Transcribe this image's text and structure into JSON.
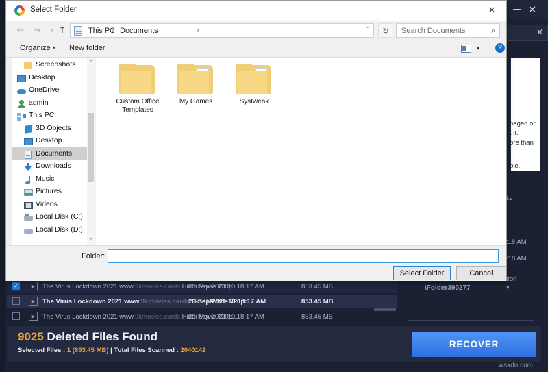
{
  "app": {
    "titlebar": {
      "minimize": "—",
      "close": "✕",
      "sub_close": "✕"
    },
    "tip_lines": [
      "naged or",
      "t it.",
      "ore than",
      ".",
      "ble."
    ],
    "right_fragments": [
      "kv",
      ":18 AM",
      ":18 AM",
      "tion",
      "y"
    ],
    "list": {
      "location_header": "tion",
      "location_value": "\\Folder390277",
      "rows": [
        {
          "checked": true,
          "name_prefix": "The Virus Lockdown 2021 www.",
          "name_dim": "9kmovies.cards",
          "name_suffix": " Hindi Movie 720p...",
          "date": "20-Sep-2021 10:18:17 AM",
          "size": "853.45 MB"
        },
        {
          "checked": false,
          "name_prefix": "The Virus Lockdown 2021 www.",
          "name_dim": "9kmovies.cards",
          "name_suffix": " Hindi Movie 720p...",
          "date": "20-Sep-2021 10:18:17 AM",
          "size": "853.45 MB"
        },
        {
          "checked": false,
          "name_prefix": "The Virus Lockdown 2021 www.",
          "name_dim": "9kmovies.cards",
          "name_suffix": " Hindi Movie 720p...",
          "date": "20-Sep-2021 10:18:17 AM",
          "size": "853.45 MB"
        }
      ]
    },
    "footer": {
      "count": "9025",
      "title_rest": " Deleted Files Found",
      "sub_label_1": "Selected Files : ",
      "sub_value_1": "1 (853.45 MB)",
      "sub_sep": " | ",
      "sub_label_2": "Total Files Scanned : ",
      "sub_value_2": "2040142",
      "recover_label": "RECOVER",
      "accent_color": "#e8a33d",
      "button_color": "#2f6fe0"
    },
    "watermark": "wsxdn.com"
  },
  "dialog": {
    "title": "Select Folder",
    "close_label": "✕",
    "nav": {
      "back": "←",
      "forward": "→",
      "recent": "▾",
      "up": "↑",
      "crumb1": "This PC",
      "crumb2": "Documents",
      "sep1": "›",
      "sep2": "›",
      "sep3": "›",
      "address_dropdown": "˅",
      "refresh": "↻"
    },
    "search": {
      "placeholder": "Search Documents",
      "icon": "⌕"
    },
    "toolbar": {
      "organize": "Organize",
      "organize_caret": "▾",
      "new_folder": "New folder",
      "view_caret": "▾",
      "help": "?"
    },
    "sidebar": [
      {
        "label": "Screenshots",
        "icon": "folder",
        "indent": 18,
        "active": false
      },
      {
        "label": "Desktop",
        "icon": "desktop",
        "indent": 8,
        "active": false
      },
      {
        "label": "OneDrive",
        "icon": "cloud",
        "indent": 8,
        "active": false
      },
      {
        "label": "admin",
        "icon": "user",
        "indent": 8,
        "active": false
      },
      {
        "label": "This PC",
        "icon": "pc",
        "indent": 8,
        "active": false
      },
      {
        "label": "3D Objects",
        "icon": "cube",
        "indent": 18,
        "active": false
      },
      {
        "label": "Desktop",
        "icon": "desktop",
        "indent": 18,
        "active": false
      },
      {
        "label": "Documents",
        "icon": "documents",
        "indent": 18,
        "active": true
      },
      {
        "label": "Downloads",
        "icon": "download",
        "indent": 18,
        "active": false
      },
      {
        "label": "Music",
        "icon": "music",
        "indent": 18,
        "active": false
      },
      {
        "label": "Pictures",
        "icon": "pictures",
        "indent": 18,
        "active": false
      },
      {
        "label": "Videos",
        "icon": "videos",
        "indent": 18,
        "active": false
      },
      {
        "label": "Local Disk (C:)",
        "icon": "drive-c",
        "indent": 18,
        "active": false
      },
      {
        "label": "Local Disk (D:)",
        "icon": "drive",
        "indent": 18,
        "active": false
      }
    ],
    "scroll": {
      "up": "˄",
      "down": "˅"
    },
    "folders": [
      {
        "label": "Custom Office Templates",
        "type": "plain"
      },
      {
        "label": "My Games",
        "type": "with-files"
      },
      {
        "label": "Systweak",
        "type": "with-files"
      }
    ],
    "bottom": {
      "folder_label": "Folder:",
      "folder_value": "",
      "select_label": "Select Folder",
      "cancel_label": "Cancel"
    }
  }
}
